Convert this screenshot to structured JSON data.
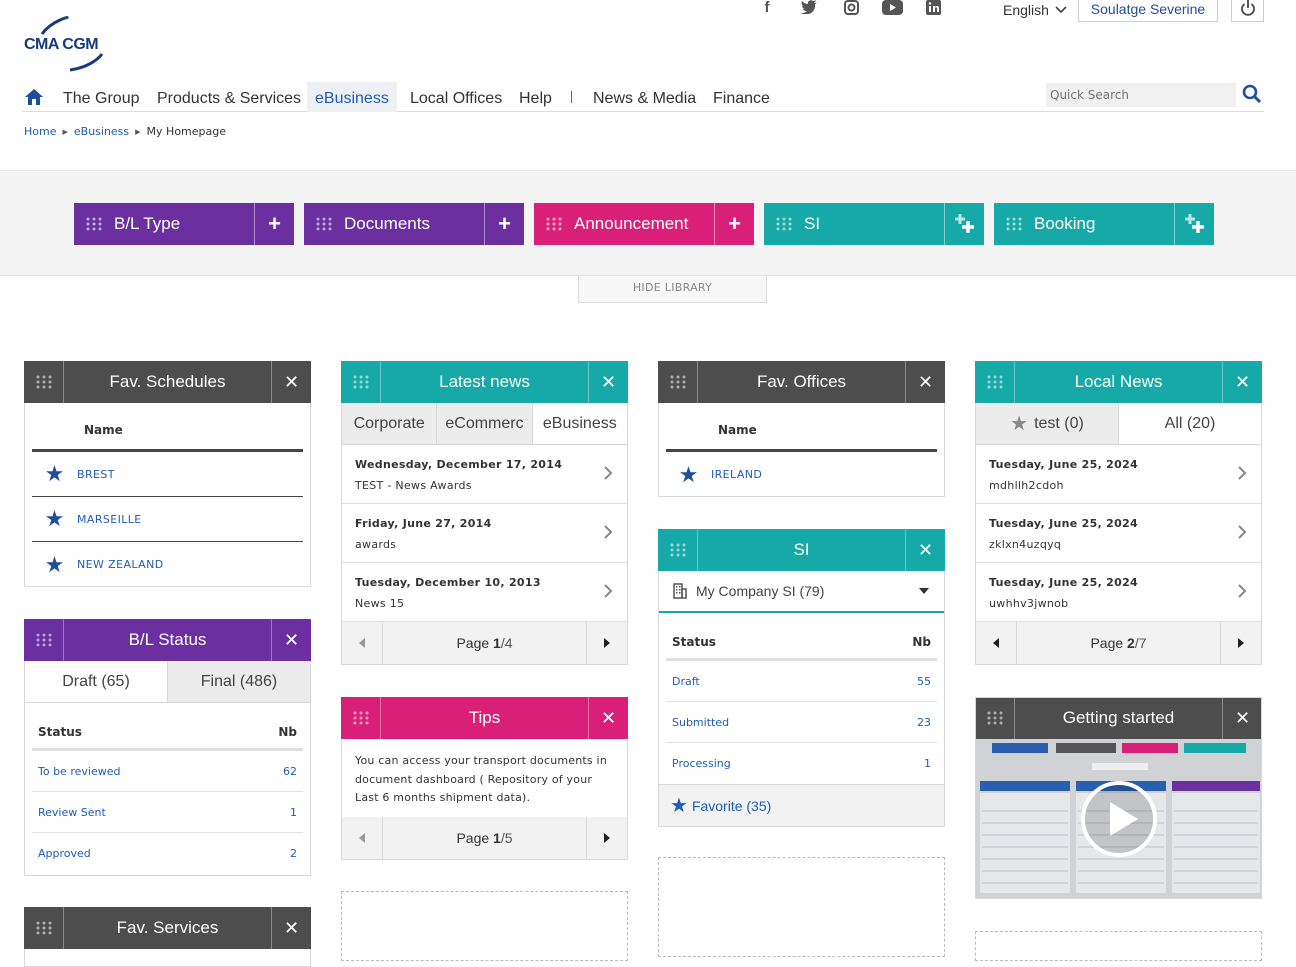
{
  "header": {
    "logo_text": "CMA CGM",
    "social": [
      "facebook-icon",
      "twitter-icon",
      "instagram-icon",
      "youtube-icon",
      "linkedin-icon"
    ],
    "language": "English",
    "user": "Soulatge Severine"
  },
  "nav": {
    "items": [
      "The Group",
      "Products & Services",
      "eBusiness",
      "Local Offices",
      "Help",
      "News & Media",
      "Finance"
    ],
    "active": "eBusiness",
    "search_placeholder": "Quick Search"
  },
  "breadcrumb": [
    "Home",
    "eBusiness",
    "My Homepage"
  ],
  "library": {
    "tiles": [
      {
        "label": "B/L Type",
        "color": "#6b2fa0"
      },
      {
        "label": "Documents",
        "color": "#6b2fa0"
      },
      {
        "label": "Announcement",
        "color": "#da1f78"
      },
      {
        "label": "SI",
        "color": "#17a8a8"
      },
      {
        "label": "Booking",
        "color": "#17a8a8"
      }
    ],
    "hide_label": "HIDE LIBRARY"
  },
  "fav_schedules": {
    "title": "Fav. Schedules",
    "col": "Name",
    "rows": [
      "BREST",
      "MARSEILLE",
      "NEW ZEALAND"
    ]
  },
  "bl_status": {
    "title": "B/L Status",
    "tabs": [
      "Draft (65)",
      "Final (486)"
    ],
    "col_status": "Status",
    "col_nb": "Nb",
    "rows": [
      {
        "status": "To be reviewed",
        "nb": "62"
      },
      {
        "status": "Review Sent",
        "nb": "1"
      },
      {
        "status": "Approved",
        "nb": "2"
      }
    ]
  },
  "fav_services": {
    "title": "Fav. Services"
  },
  "latest_news": {
    "title": "Latest news",
    "tabs": [
      "Corporate",
      "eCommerc",
      "eBusiness"
    ],
    "rows": [
      {
        "date": "Wednesday, December 17, 2014",
        "sub": "TEST - News Awards"
      },
      {
        "date": "Friday, June 27, 2014",
        "sub": "awards"
      },
      {
        "date": "Tuesday, December 10, 2013",
        "sub": "News 15"
      }
    ],
    "page_word": "Page ",
    "page_cur": "1",
    "page_total": "/4"
  },
  "tips": {
    "title": "Tips",
    "text": "You can access your transport documents in document dashboard ( Repository of your Last 6 months shipment data).",
    "page_word": "Page ",
    "page_cur": "1",
    "page_total": "/5"
  },
  "fav_offices": {
    "title": "Fav. Offices",
    "col": "Name",
    "rows": [
      "IRELAND"
    ]
  },
  "si": {
    "title": "SI",
    "select": "My Company SI (79)",
    "col_status": "Status",
    "col_nb": "Nb",
    "rows": [
      {
        "status": "Draft",
        "nb": "55"
      },
      {
        "status": "Submitted",
        "nb": "23"
      },
      {
        "status": "Processing",
        "nb": "1"
      }
    ],
    "favorite": "Favorite (35)"
  },
  "local_news": {
    "title": "Local News",
    "tabs": [
      "test (0)",
      "All (20)"
    ],
    "rows": [
      {
        "date": "Tuesday, June 25, 2024",
        "sub": "mdhllh2cdoh"
      },
      {
        "date": "Tuesday, June 25, 2024",
        "sub": "zklxn4uzqyq"
      },
      {
        "date": "Tuesday, June 25, 2024",
        "sub": "uwhhv3jwnob"
      }
    ],
    "page_word": "Page ",
    "page_cur": "2",
    "page_total": "/7"
  },
  "getting_started": {
    "title": "Getting started"
  },
  "colors": {
    "purple": "#6b2fa0",
    "pink": "#da1f78",
    "teal": "#17a8a8",
    "dark": "#4d4d4d",
    "link": "#1f5db8"
  }
}
